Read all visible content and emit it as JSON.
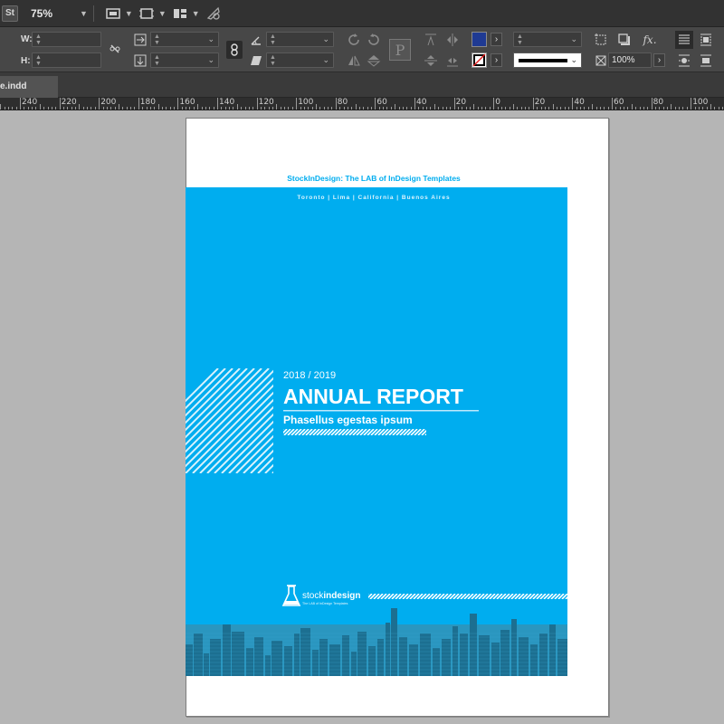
{
  "appbar": {
    "logo": "St",
    "zoom": "75%",
    "icons": [
      "screen-mode-icon",
      "view-options-icon",
      "arrange-documents-icon",
      "publish-online-icon"
    ]
  },
  "control_panel": {
    "w_label": "W:",
    "h_label": "H:",
    "stroke_percent": "100%",
    "fill_color": "#1f3a93",
    "icons": [
      "constrain-proportions-icon",
      "scale-x-icon",
      "scale-y-icon",
      "rotate-icon",
      "shear-icon",
      "rotate-cw-icon",
      "rotate-ccw-icon",
      "flip-horizontal-icon",
      "flip-vertical-icon",
      "path-type-icon",
      "align-top-icon",
      "align-center-icon",
      "align-bottom-icon",
      "fill-swatch-icon",
      "stroke-swatch-icon",
      "frame-fitting-icon",
      "drop-shadow-icon",
      "effects-icon",
      "text-wrap-icon"
    ]
  },
  "document": {
    "tab_label": "e.indd"
  },
  "ruler": {
    "labels": [
      "240",
      "220",
      "200",
      "180",
      "160",
      "140",
      "120",
      "100",
      "80",
      "60",
      "40",
      "20",
      "0",
      "20",
      "40",
      "60",
      "80",
      "100"
    ]
  },
  "cover": {
    "brand_color": "#00adef",
    "header": "StockInDesign: The LAB of InDesign Templates",
    "locations": "Toronto | Lima | California | Buenos Aires",
    "year": "2018 / 2019",
    "title": "ANNUAL REPORT",
    "subtitle": "Phasellus egestas ipsum",
    "logo_name_light": "stock",
    "logo_name_bold": "indesign",
    "logo_tagline": "The LAB of InDesign Templates"
  }
}
